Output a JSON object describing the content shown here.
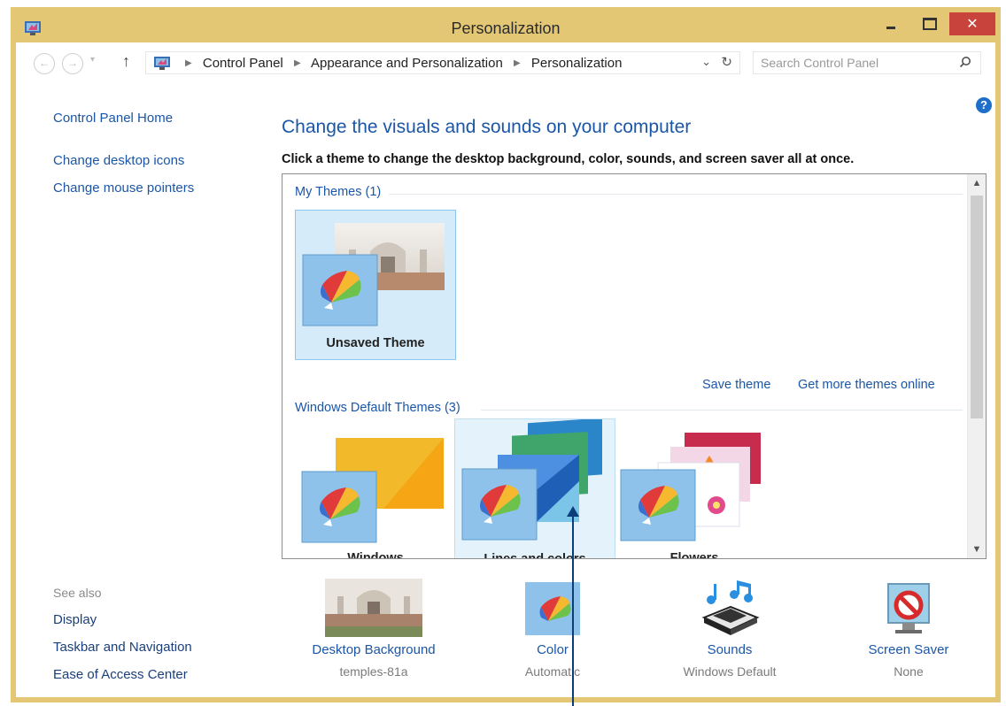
{
  "window": {
    "title": "Personalization"
  },
  "navigation": {
    "breadcrumbs": [
      "Control Panel",
      "Appearance and Personalization",
      "Personalization"
    ],
    "search_placeholder": "Search Control Panel"
  },
  "sidebar": {
    "links": [
      "Control Panel Home",
      "Change desktop icons",
      "Change mouse pointers"
    ],
    "see_also_title": "See also",
    "see_also_links": [
      "Display",
      "Taskbar and Navigation",
      "Ease of Access Center"
    ]
  },
  "main": {
    "heading": "Change the visuals and sounds on your computer",
    "subheading": "Click a theme to change the desktop background, color, sounds, and screen saver all at once.",
    "my_themes": {
      "title": "My Themes (1)",
      "themes": [
        {
          "name": "Unsaved Theme",
          "selected": true
        }
      ]
    },
    "actions": [
      "Save theme",
      "Get more themes online"
    ],
    "default_themes": {
      "title": "Windows Default Themes (3)",
      "themes": [
        {
          "name": "Windows"
        },
        {
          "name": "Lines and colors",
          "hovered": true
        },
        {
          "name": "Flowers"
        }
      ]
    }
  },
  "bottom_bar": [
    {
      "label": "Desktop Background",
      "value": "temples-81a",
      "icon": "desktop-background-icon"
    },
    {
      "label": "Color",
      "value": "Automatic",
      "icon": "color-icon"
    },
    {
      "label": "Sounds",
      "value": "Windows Default",
      "icon": "sounds-icon"
    },
    {
      "label": "Screen Saver",
      "value": "None",
      "icon": "screen-saver-icon"
    }
  ],
  "colors": {
    "title_bar": "#e3c774",
    "link": "#1b56a7",
    "close_button": "#c7433b",
    "selection": "#d6ebf9"
  }
}
